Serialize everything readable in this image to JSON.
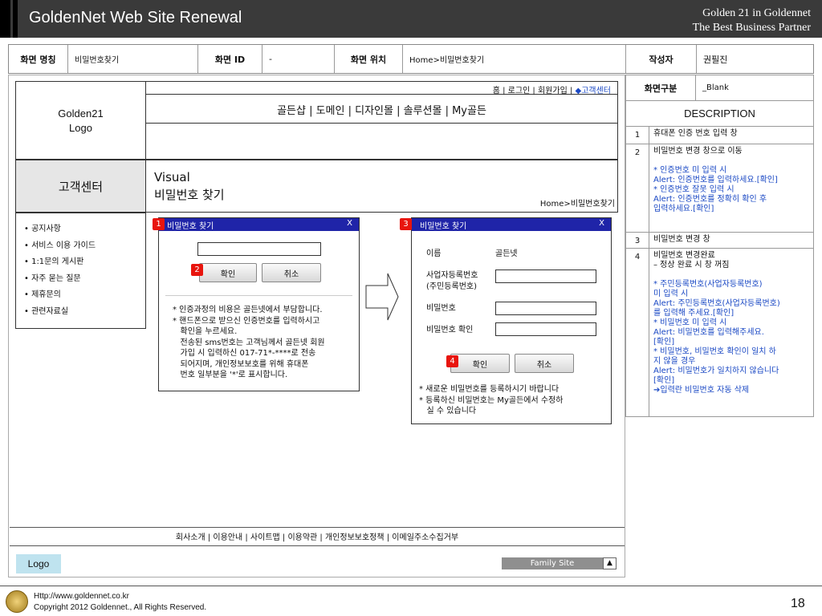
{
  "header": {
    "title": "GoldenNet Web Site Renewal",
    "sub1": "Golden 21 in Goldennet",
    "sub2": "The Best Business Partner"
  },
  "info": {
    "screen_name_label": "화면 명칭",
    "screen_name": "비밀번호찾기",
    "screen_id_label": "화면 ID",
    "screen_id": "-",
    "location_label": "화면 위치",
    "location": "Home>비밀번호찾기",
    "author_label": "작성자",
    "author": "권필진"
  },
  "wire": {
    "logo_line1": "Golden21",
    "logo_line2": "Logo",
    "topnav_plain": "홈 | 로그인 | 회원가입 | ",
    "topnav_highlight": "◆고객센터",
    "gnb": "골든샵 | 도메인 | 디자인몰 | 솔루션몰 | My골든",
    "section_title": "고객센터",
    "visual_label": "Visual",
    "visual_title": "비밀번호 찾기",
    "breadcrumb": "Home>비밀번호찾기",
    "lnb": [
      "• 공지사항",
      "• 서비스 이용 가이드",
      "• 1:1문의 게시판",
      "• 자주 묻는 질문",
      "• 제휴문의",
      "• 관련자료실"
    ]
  },
  "popup1": {
    "badge": "1",
    "title": "비밀번호 찾기",
    "close": "X",
    "badge2": "2",
    "confirm": "확인",
    "cancel": "취소",
    "notes": [
      "* 인증과정의 비용은 골든넷에서 부담합니다.",
      "* 핸드폰으로 받으신 인증번호를 입력하시고",
      "   확인을 누르세요.",
      "   전송된 sms번호는 고객님께서 골든넷 회원",
      "   가입 시 입력하신 017-71*-****로 전송",
      "   되어지며, 개인정보보호를 위해 휴대폰",
      "   번호 일부분을 '*'로 표시합니다."
    ]
  },
  "popup3": {
    "badge": "3",
    "title": "비밀번호 찾기",
    "close": "X",
    "name_label": "이름",
    "name_value": "골든넷",
    "biz_label": "사업자등록번호",
    "biz_label2": "(주민등록번호)",
    "pw_label": "비밀번호",
    "pw_confirm_label": "비밀번호 확인",
    "badge4": "4",
    "confirm": "확인",
    "cancel": "취소",
    "notes": [
      "* 새로운 비밀번호를 등록하시기 바랍니다",
      "* 등록하신 비밀번호는 My골든에서 수정하",
      "   실 수 있습니다"
    ]
  },
  "desc": {
    "type_label": "화면구분",
    "type_value": "_Blank",
    "heading": "DESCRIPTION",
    "rows": [
      {
        "num": "1",
        "lines": [
          {
            "t": "휴대폰 인증 번호 입력 창",
            "blue": false
          }
        ]
      },
      {
        "num": "2",
        "lines": [
          {
            "t": "비밀번호 변경 창으로 이동",
            "blue": false
          },
          {
            "t": "",
            "blue": false
          },
          {
            "t": "* 인증번호 미 입력 시",
            "blue": true
          },
          {
            "t": "Alert: 인증번호를 입력하세요.[확인]",
            "blue": true
          },
          {
            "t": "* 인증번호 잘못 입력 시",
            "blue": true
          },
          {
            "t": "Alert: 인증번호를 정확히 확인 후",
            "blue": true
          },
          {
            "t": "입력하세요.[확인]",
            "blue": true
          }
        ]
      },
      {
        "num": "3",
        "lines": [
          {
            "t": "비밀번호 변경 창",
            "blue": false
          }
        ]
      },
      {
        "num": "4",
        "lines": [
          {
            "t": "비밀번호 변경완료",
            "blue": false
          },
          {
            "t": "– 정상 완료 시 창 꺼짐",
            "blue": false
          },
          {
            "t": "",
            "blue": false
          },
          {
            "t": "* 주민등록번호(사업자등록번호)",
            "blue": true
          },
          {
            "t": "미 입력 시",
            "blue": true
          },
          {
            "t": "Alert: 주민등록번호(사업자등록번호)",
            "blue": true
          },
          {
            "t": "를 입력해 주세요.[확인]",
            "blue": true
          },
          {
            "t": "* 비밀번호 미 입력 시",
            "blue": true
          },
          {
            "t": "Alert: 비밀번호를 입력해주세요.",
            "blue": true
          },
          {
            "t": "[확인]",
            "blue": true
          },
          {
            "t": "* 비밀번호, 비밀번호 확인이 일치 하",
            "blue": true
          },
          {
            "t": "지 않을 경우",
            "blue": true
          },
          {
            "t": "Alert: 비밀번호가 일치하지 않습니다",
            "blue": true
          },
          {
            "t": "[확인]",
            "blue": true
          },
          {
            "t": "➔입력란 비밀번호 자동 삭제",
            "blue": true
          }
        ]
      }
    ]
  },
  "footer": {
    "nav": "회사소개 | 이용안내 | 사이트맵 | 이용약관 | 개인정보보호정책 | 이메일주소수집거부",
    "logo": "Logo",
    "family_site": "Family Site",
    "family_btn": "▲",
    "url": "Http://www.goldennet.co.kr",
    "copyright": "Copyright 2012 Goldennet., All Rights Reserved.",
    "page": "18"
  },
  "colors": {
    "popup_title_bg": "#1f24a8",
    "badge": "#e8150e",
    "highlight": "#1a48c4",
    "header_bg": "#3a3a3a",
    "logo_bg": "#bfe3ef"
  }
}
